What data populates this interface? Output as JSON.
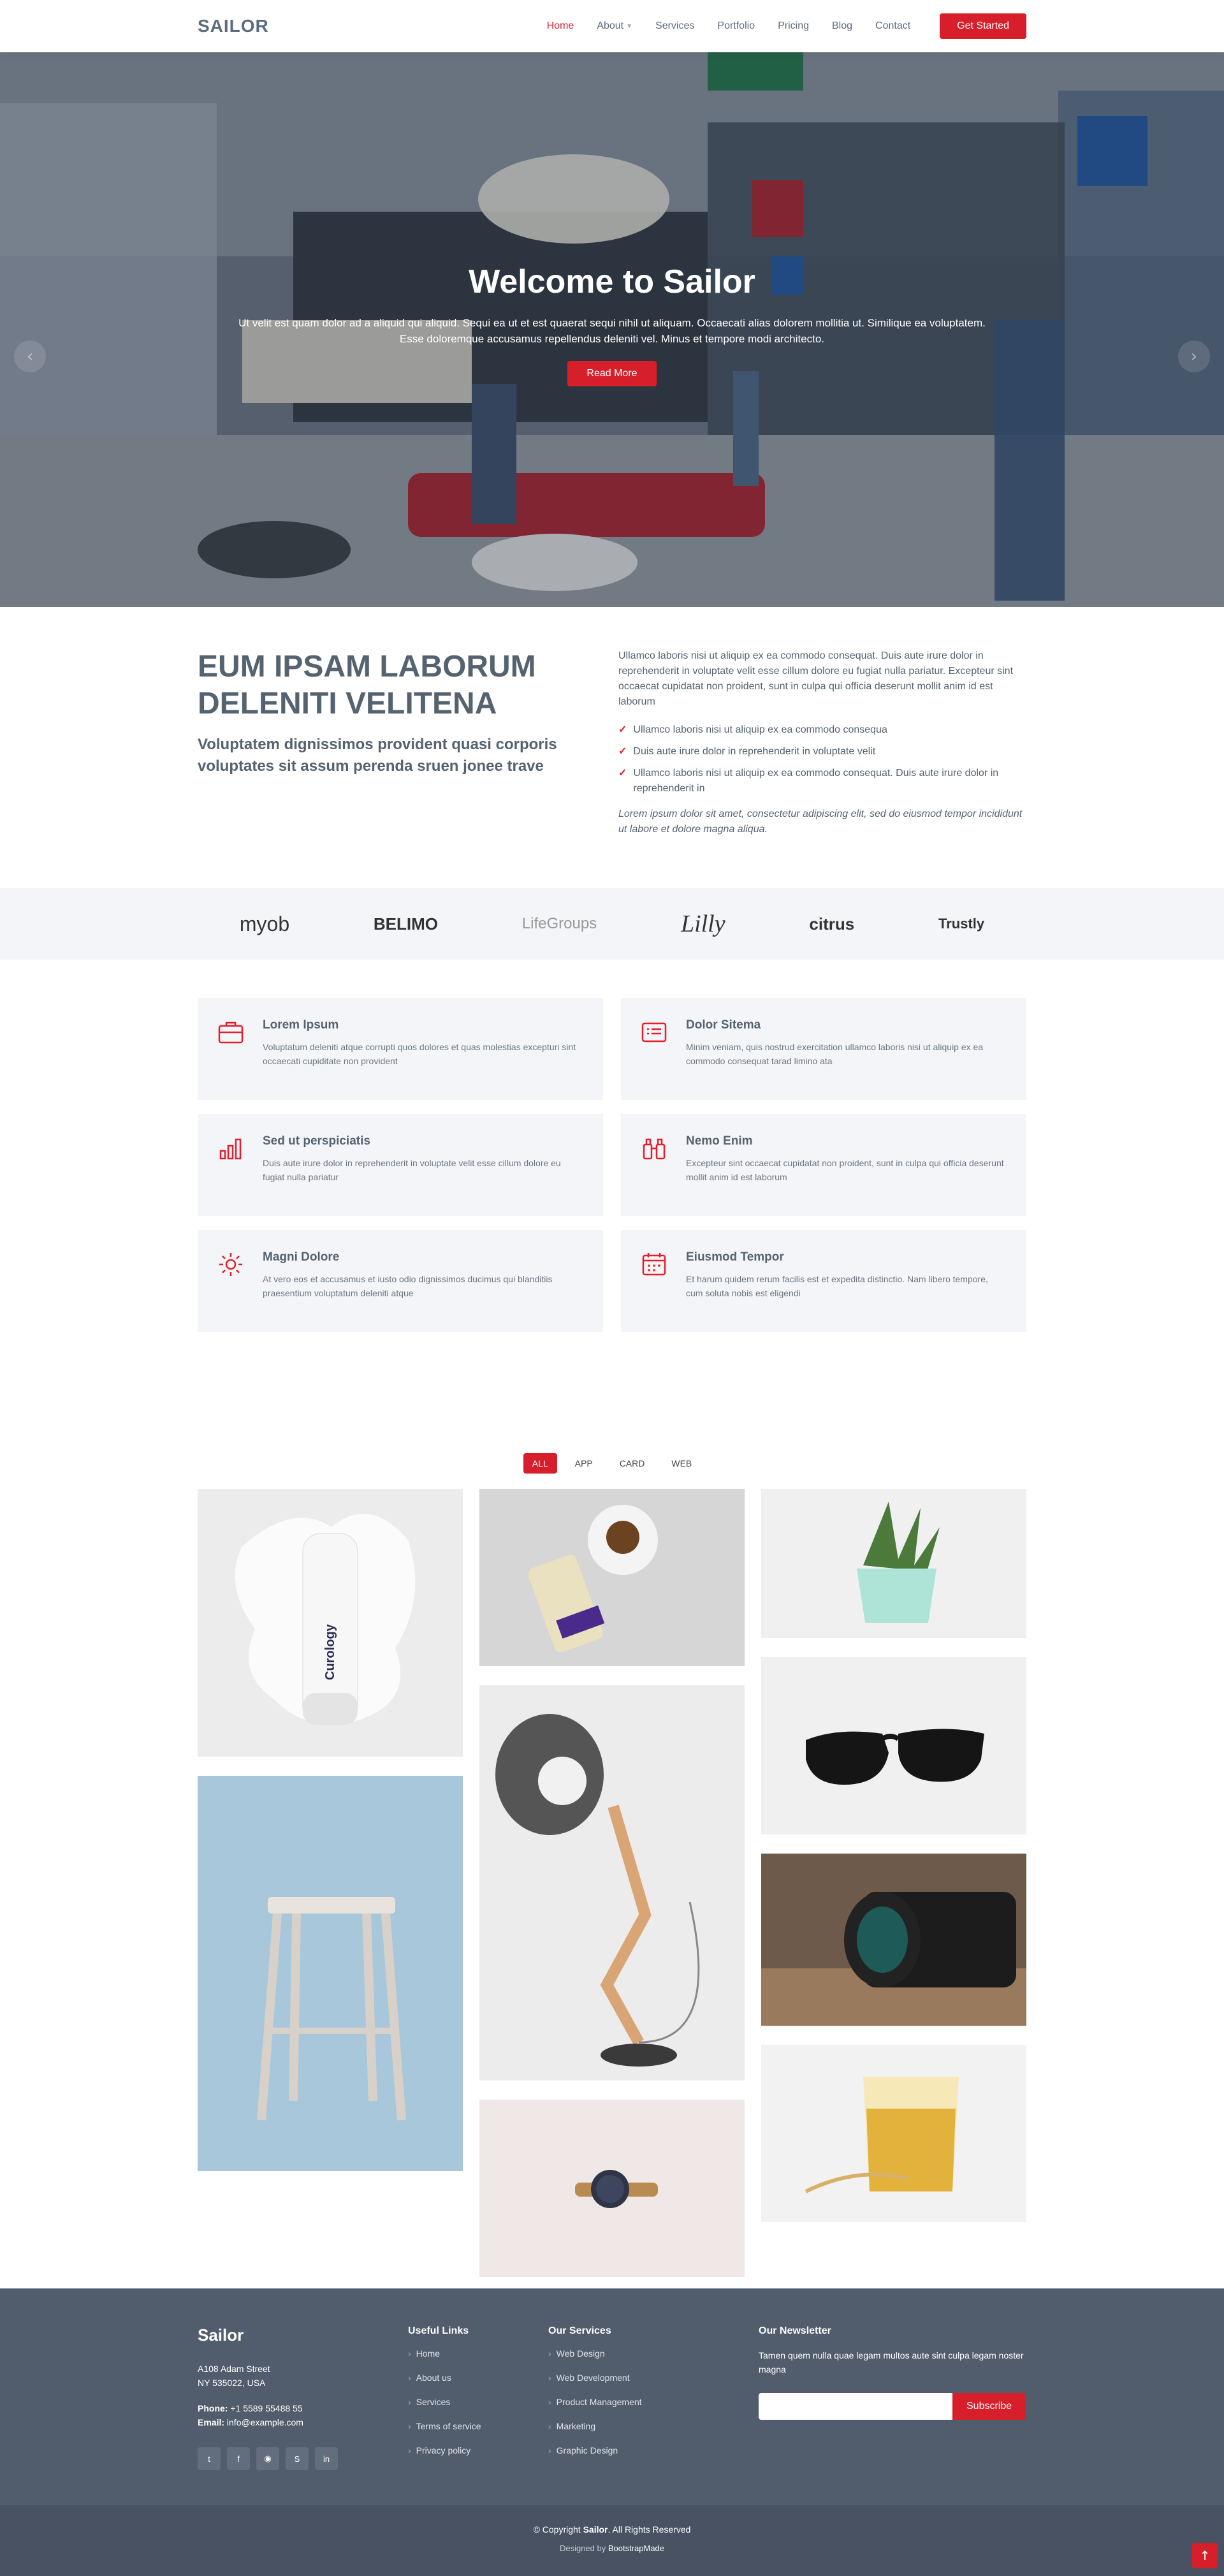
{
  "header": {
    "logo": "SAILOR",
    "nav": [
      {
        "label": "Home",
        "active": true
      },
      {
        "label": "About"
      },
      {
        "label": "Services"
      },
      {
        "label": "Portfolio"
      },
      {
        "label": "Pricing"
      },
      {
        "label": "Blog"
      },
      {
        "label": "Contact"
      }
    ],
    "cta": "Get Started"
  },
  "hero": {
    "title": "Welcome to Sailor",
    "text": "Ut velit est quam dolor ad a aliquid qui aliquid. Sequi ea ut et est quaerat sequi nihil ut aliquam. Occaecati alias dolorem mollitia ut. Similique ea voluptatem. Esse doloremque accusamus repellendus deleniti vel. Minus et tempore modi architecto.",
    "button": "Read More",
    "slides": 3,
    "active_slide": 1
  },
  "about": {
    "title": "EUM IPSAM LABORUM DELENITI VELITENA",
    "subtitle": "Voluptatem dignissimos provident quasi corporis voluptates sit assum perenda sruen jonee trave",
    "intro": "Ullamco laboris nisi ut aliquip ex ea commodo consequat. Duis aute irure dolor in reprehenderit in voluptate velit esse cillum dolore eu fugiat nulla pariatur. Excepteur sint occaecat cupidatat non proident, sunt in culpa qui officia deserunt mollit anim id est laborum",
    "bullets": [
      "Ullamco laboris nisi ut aliquip ex ea commodo consequa",
      "Duis aute irure dolor in reprehenderit in voluptate velit",
      "Ullamco laboris nisi ut aliquip ex ea commodo consequat. Duis aute irure dolor in reprehenderit in"
    ],
    "closing": "Lorem ipsum dolor sit amet, consectetur adipiscing elit, sed do eiusmod tempor incididunt ut labore et dolore magna aliqua."
  },
  "clients": [
    "myob",
    "BELIMO",
    "LifeGroups",
    "Lilly",
    "citrus",
    "Trustly"
  ],
  "services": [
    {
      "icon": "briefcase-icon",
      "title": "Lorem Ipsum",
      "text": "Voluptatum deleniti atque corrupti quos dolores et quas molestias excepturi sint occaecati cupiditate non provident"
    },
    {
      "icon": "card-list-icon",
      "title": "Dolor Sitema",
      "text": "Minim veniam, quis nostrud exercitation ullamco laboris nisi ut aliquip ex ea commodo consequat tarad limino ata"
    },
    {
      "icon": "bar-chart-icon",
      "title": "Sed ut perspiciatis",
      "text": "Duis aute irure dolor in reprehenderit in voluptate velit esse cillum dolore eu fugiat nulla pariatur"
    },
    {
      "icon": "binoculars-icon",
      "title": "Nemo Enim",
      "text": "Excepteur sint occaecat cupidatat non proident, sunt in culpa qui officia deserunt mollit anim id est laborum"
    },
    {
      "icon": "brightness-icon",
      "title": "Magni Dolore",
      "text": "At vero eos et accusamus et iusto odio dignissimos ducimus qui blanditiis praesentium voluptatum deleniti atque"
    },
    {
      "icon": "calendar-icon",
      "title": "Eiusmod Tempor",
      "text": "Et harum quidem rerum facilis est et expedita distinctio. Nam libero tempore, cum soluta nobis est eligendi"
    }
  ],
  "portfolio": {
    "filters": [
      "ALL",
      "APP",
      "CARD",
      "WEB"
    ],
    "active_filter": "ALL",
    "items": [
      {
        "name": "Curology bottle",
        "label": "Curology"
      },
      {
        "name": "Coffee and snack"
      },
      {
        "name": "Succulent plant"
      },
      {
        "name": "Sunglasses"
      },
      {
        "name": "Wooden stool"
      },
      {
        "name": "Desk lamp"
      },
      {
        "name": "Camera lens"
      },
      {
        "name": "Wrist watch"
      },
      {
        "name": "Glass of drink"
      }
    ]
  },
  "footer": {
    "brand": "Sailor",
    "address_line1": "A108 Adam Street",
    "address_line2": "NY 535022, USA",
    "phone_label": "Phone:",
    "phone": "+1 5589 55488 55",
    "email_label": "Email:",
    "email": "info@example.com",
    "socials": [
      "twitter-icon",
      "facebook-icon",
      "instagram-icon",
      "skype-icon",
      "linkedin-icon"
    ],
    "useful_links_title": "Useful Links",
    "useful_links": [
      "Home",
      "About us",
      "Services",
      "Terms of service",
      "Privacy policy"
    ],
    "services_title": "Our Services",
    "services_links": [
      "Web Design",
      "Web Development",
      "Product Management",
      "Marketing",
      "Graphic Design"
    ],
    "newsletter_title": "Our Newsletter",
    "newsletter_text": "Tamen quem nulla quae legam multos aute sint culpa legam noster magna",
    "subscribe": "Subscribe",
    "copyright_prefix": "© Copyright",
    "copyright_brand": "Sailor",
    "copyright_suffix": ". All Rights Reserved",
    "designed_by": "Designed by",
    "designer": "BootstrapMade"
  },
  "colors": {
    "accent": "#d61f2b",
    "text": "#556270",
    "footer": "#515c6d"
  }
}
